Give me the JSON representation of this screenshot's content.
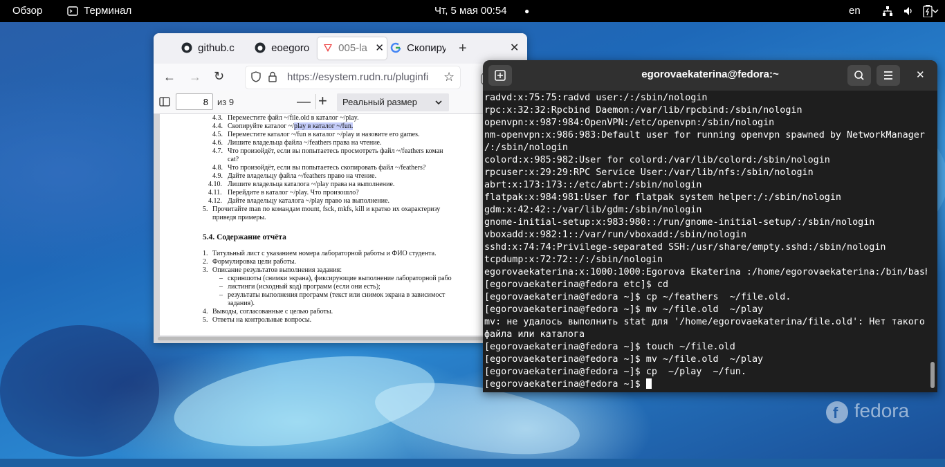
{
  "topbar": {
    "overview": "Обзор",
    "app_name": "Терминал",
    "datetime": "Чт, 5 мая  00:54",
    "lang": "en"
  },
  "browser": {
    "tabs": [
      {
        "label": "github.c",
        "icon": "github-icon"
      },
      {
        "label": "eoegoro",
        "icon": "github-icon"
      },
      {
        "label": "005-la",
        "icon": "pdf-icon"
      },
      {
        "label": "Скопиру",
        "icon": "google-icon"
      }
    ],
    "url": "https://esystem.rudn.ru/pluginfi",
    "url_domain": "rudn.ru",
    "pdf": {
      "page_number": "8",
      "page_total": "из 9",
      "zoom": "Реальный размер"
    }
  },
  "pdf_lines": [
    {
      "num": "4.3.",
      "text": "Переместите файл ~/file.old в каталог ~/play."
    },
    {
      "num": "4.4.",
      "text": "Скопируйте каталог ~/play в каталог ~/fun."
    },
    {
      "num": "4.5.",
      "text": "Переместите каталог ~/fun в каталог ~/play и назовите его games."
    },
    {
      "num": "4.6.",
      "text": "Лишите владельца файла ~/feathers права на чтение."
    },
    {
      "num": "4.7.",
      "text": "Что произойдёт, если вы попытаетесь просмотреть файл ~/feathers коман"
    },
    {
      "num": "",
      "text": "cat?"
    },
    {
      "num": "4.8.",
      "text": "Что произойдёт, если вы попытаетесь скопировать файл ~/feathers?"
    },
    {
      "num": "4.9.",
      "text": "Дайте владельцу файла ~/feathers право на чтение."
    },
    {
      "num": "4.10.",
      "text": "Лишите владельца каталога ~/play права на выполнение."
    },
    {
      "num": "4.11.",
      "text": "Перейдите в каталог ~/play. Что произошло?"
    },
    {
      "num": "4.12.",
      "text": "Дайте владельцу каталога ~/play право на выполнение."
    },
    {
      "num": "5.",
      "text": "Прочитайте man по командам mount, fsck, mkfs, kill и кратко их охарактеризу"
    },
    {
      "num": "",
      "text": "приведя примеры."
    }
  ],
  "pdf_section": {
    "heading": "5.4.   Содержание отчёта",
    "items": [
      {
        "num": "1.",
        "text": "Титульный лист с указанием номера лабораторной работы и ФИО студента."
      },
      {
        "num": "2.",
        "text": "Формулировка цели работы."
      },
      {
        "num": "3.",
        "text": "Описание результатов выполнения задания:"
      },
      {
        "num": "–",
        "text": "скриншоты (снимки экрана), фиксирующие выполнение лабораторной рабо"
      },
      {
        "num": "–",
        "text": "листинги (исходный код) программ (если они есть);"
      },
      {
        "num": "–",
        "text": "результаты выполнения программ (текст или снимок экрана в зависимост"
      },
      {
        "num": "",
        "text": "задания)."
      },
      {
        "num": "4.",
        "text": "Выводы, согласованные с целью работы."
      },
      {
        "num": "5.",
        "text": "Ответы на контрольные вопросы."
      }
    ]
  },
  "terminal": {
    "title": "egorovaekaterina@fedora:~",
    "lines": [
      "radvd:x:75:75:radvd user:/:/sbin/nologin",
      "rpc:x:32:32:Rpcbind Daemon:/var/lib/rpcbind:/sbin/nologin",
      "openvpn:x:987:984:OpenVPN:/etc/openvpn:/sbin/nologin",
      "nm-openvpn:x:986:983:Default user for running openvpn spawned by NetworkManager:",
      "/:/sbin/nologin",
      "colord:x:985:982:User for colord:/var/lib/colord:/sbin/nologin",
      "rpcuser:x:29:29:RPC Service User:/var/lib/nfs:/sbin/nologin",
      "abrt:x:173:173::/etc/abrt:/sbin/nologin",
      "flatpak:x:984:981:User for flatpak system helper:/:/sbin/nologin",
      "gdm:x:42:42::/var/lib/gdm:/sbin/nologin",
      "gnome-initial-setup:x:983:980::/run/gnome-initial-setup/:/sbin/nologin",
      "vboxadd:x:982:1::/var/run/vboxadd:/sbin/nologin",
      "sshd:x:74:74:Privilege-separated SSH:/usr/share/empty.sshd:/sbin/nologin",
      "tcpdump:x:72:72::/:/sbin/nologin",
      "egorovaekaterina:x:1000:1000:Egorova Ekaterina :/home/egorovaekaterina:/bin/bash",
      "[egorovaekaterina@fedora etc]$ cd",
      "[egorovaekaterina@fedora ~]$ cp ~/feathers  ~/file.old.",
      "[egorovaekaterina@fedora ~]$ mv ~/file.old  ~/play",
      "mv: не удалось выполнить stat для '/home/egorovaekaterina/file.old': Нет такого",
      "файла или каталога",
      "[egorovaekaterina@fedora ~]$ touch ~/file.old",
      "[egorovaekaterina@fedora ~]$ mv ~/file.old  ~/play",
      "[egorovaekaterina@fedora ~]$ cp  ~/play  ~/fun.",
      "[egorovaekaterina@fedora ~]$ "
    ]
  },
  "desktop": {
    "brand": "fedora"
  }
}
